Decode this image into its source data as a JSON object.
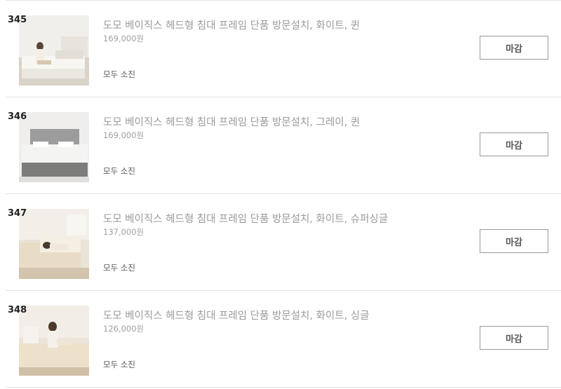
{
  "items": [
    {
      "rank": "345",
      "title": "도모 베이직스 헤드형 침대 프레임 단품 방문설치, 화이트, 퀸",
      "price": "169,000원",
      "status": "모두 소진",
      "button": "마감",
      "image": "white-bed-woman-kneeling-photo"
    },
    {
      "rank": "346",
      "title": "도모 베이직스 헤드형 침대 프레임 단품 방문설치, 그레이, 퀸",
      "price": "169,000원",
      "status": "모두 소진",
      "button": "마감",
      "image": "gray-bed-photo"
    },
    {
      "rank": "347",
      "title": "도모 베이직스 헤드형 침대 프레임 단품 방문설치, 화이트, 슈퍼싱글",
      "price": "137,000원",
      "status": "모두 소진",
      "button": "마감",
      "image": "white-supersingle-bed-woman-lying-photo"
    },
    {
      "rank": "348",
      "title": "도모 베이직스 헤드형 침대 프레임 단품 방문설치, 화이트, 싱글",
      "price": "126,000원",
      "status": "모두 소진",
      "button": "마감",
      "image": "white-single-bed-woman-sitting-photo"
    }
  ]
}
